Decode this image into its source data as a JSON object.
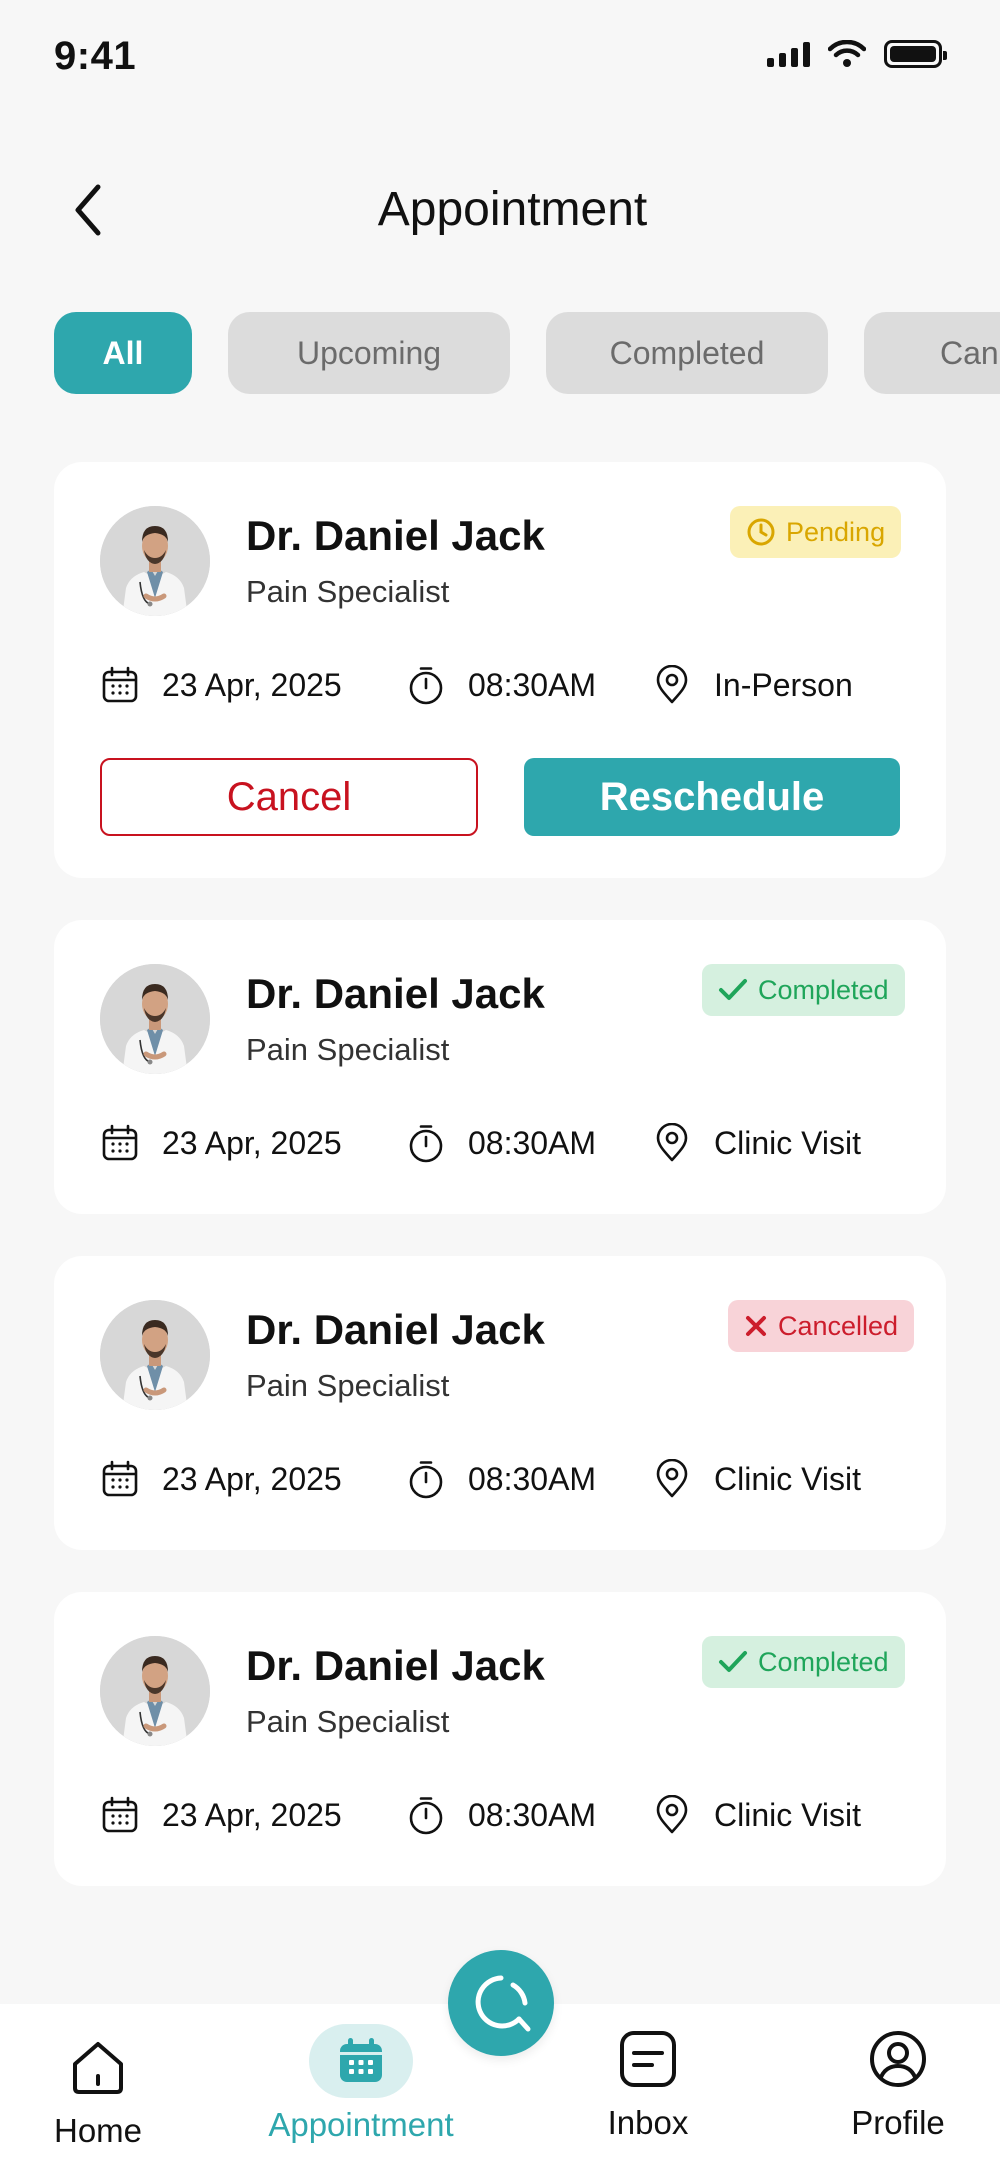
{
  "status_bar": {
    "time": "9:41"
  },
  "header": {
    "title": "Appointment"
  },
  "tabs": [
    {
      "label": "All",
      "active": true
    },
    {
      "label": "Upcoming",
      "active": false
    },
    {
      "label": "Completed",
      "active": false
    },
    {
      "label": "Cancelled",
      "active": false
    }
  ],
  "appointments": [
    {
      "doctor_name": "Dr. Daniel Jack",
      "specialty": "Pain Specialist",
      "status": "Pending",
      "date": "23 Apr, 2025",
      "time": "08:30AM",
      "visit_type": "In-Person",
      "cancel_label": "Cancel",
      "reschedule_label": "Reschedule"
    },
    {
      "doctor_name": "Dr. Daniel Jack",
      "specialty": "Pain Specialist",
      "status": "Completed",
      "date": "23 Apr, 2025",
      "time": "08:30AM",
      "visit_type": "Clinic Visit"
    },
    {
      "doctor_name": "Dr. Daniel Jack",
      "specialty": "Pain Specialist",
      "status": "Cancelled",
      "date": "23 Apr, 2025",
      "time": "08:30AM",
      "visit_type": "Clinic Visit"
    },
    {
      "doctor_name": "Dr. Daniel Jack",
      "specialty": "Pain Specialist",
      "status": "Completed",
      "date": "23 Apr, 2025",
      "time": "08:30AM",
      "visit_type": "Clinic Visit"
    }
  ],
  "bottom_nav": {
    "home": "Home",
    "appointment": "Appointment",
    "inbox": "Inbox",
    "profile": "Profile"
  },
  "colors": {
    "accent": "#2ea7ad",
    "pending": "#d9a600",
    "completed": "#1fa55a",
    "cancelled": "#cc1d2c"
  }
}
